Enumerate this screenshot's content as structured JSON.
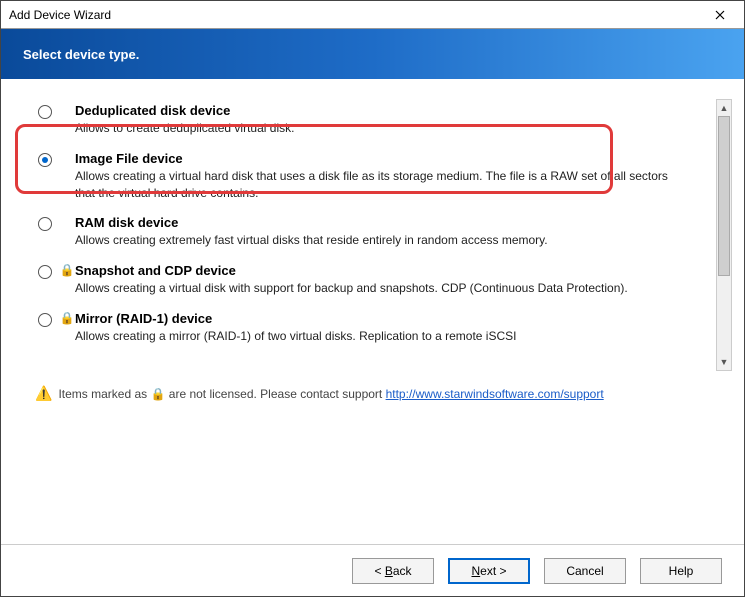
{
  "window": {
    "title": "Add Device Wizard",
    "close_tooltip": "Close"
  },
  "header": {
    "text": "Select device type."
  },
  "options": [
    {
      "id": "deduplicated",
      "selected": false,
      "locked": false,
      "title": "Deduplicated disk device",
      "desc": "Allows to create deduplicated virtual disk."
    },
    {
      "id": "imagefile",
      "selected": true,
      "locked": false,
      "highlight": true,
      "title": "Image File device",
      "desc": "Allows creating a virtual hard disk that uses a disk file as its storage medium. The file is a RAW set of all sectors that the virtual hard drive contains."
    },
    {
      "id": "ramdisk",
      "selected": false,
      "locked": false,
      "title": "RAM disk device",
      "desc": "Allows creating extremely fast virtual disks that reside entirely in random access memory."
    },
    {
      "id": "snapshot",
      "selected": false,
      "locked": true,
      "title": "Snapshot and CDP device",
      "desc": "Allows creating a virtual disk with support for backup and snapshots. CDP (Continuous Data Protection)."
    },
    {
      "id": "mirror",
      "selected": false,
      "locked": true,
      "title": "Mirror (RAID-1) device",
      "desc": "Allows creating a mirror (RAID-1) of two virtual disks. Replication to a remote iSCSI"
    }
  ],
  "footer_note": {
    "prefix": "Items marked as",
    "mid": "are not licensed. Please contact support",
    "link_text": "http://www.starwindsoftware.com/support",
    "link_href": "http://www.starwindsoftware.com/support"
  },
  "buttons": {
    "back_prefix": "< ",
    "back_u": "B",
    "back_suffix": "ack",
    "next_u": "N",
    "next_suffix": "ext >",
    "cancel": "Cancel",
    "help": "Help"
  }
}
